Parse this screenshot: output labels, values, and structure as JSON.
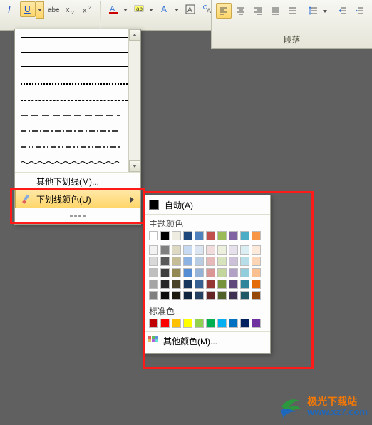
{
  "ribbon": {
    "paragraph_label": "段落"
  },
  "underline_panel": {
    "other_styles": "其他下划线(M)...",
    "color_menu": "下划线颜色(U)"
  },
  "color_panel": {
    "auto": "自动(A)",
    "theme_header": "主题颜色",
    "standard_header": "标准色",
    "more": "其他颜色(M)...",
    "theme_row_main": [
      "#ffffff",
      "#000000",
      "#eeece1",
      "#1f497d",
      "#4f81bd",
      "#c0504d",
      "#9bbb59",
      "#8064a2",
      "#4bacc6",
      "#f79646"
    ],
    "theme_shades": [
      [
        "#f2f2f2",
        "#7f7f7f",
        "#ddd9c3",
        "#c6d9f0",
        "#dbe5f1",
        "#f2dcdb",
        "#ebf1dd",
        "#e5e0ec",
        "#dbeef3",
        "#fdeada"
      ],
      [
        "#d8d8d8",
        "#595959",
        "#c4bd97",
        "#8db3e2",
        "#b8cce4",
        "#e5b9b7",
        "#d7e3bc",
        "#ccc1d9",
        "#b7dde8",
        "#fbd5b5"
      ],
      [
        "#bfbfbf",
        "#3f3f3f",
        "#938953",
        "#548dd4",
        "#95b3d7",
        "#d99694",
        "#c3d69b",
        "#b2a1c7",
        "#92cddc",
        "#fac08f"
      ],
      [
        "#a5a5a5",
        "#262626",
        "#494429",
        "#17365d",
        "#366092",
        "#953734",
        "#76923c",
        "#5f497a",
        "#31859b",
        "#e36c09"
      ],
      [
        "#7f7f7f",
        "#0c0c0c",
        "#1d1b10",
        "#0f243e",
        "#244061",
        "#632423",
        "#4f6128",
        "#3f3151",
        "#205867",
        "#974806"
      ]
    ],
    "standard": [
      "#c00000",
      "#ff0000",
      "#ffc000",
      "#ffff00",
      "#92d050",
      "#00b050",
      "#00b0f0",
      "#0070c0",
      "#002060",
      "#7030a0"
    ]
  },
  "watermark": {
    "line1": "极光下载站",
    "line2": "www.xz7.com"
  }
}
